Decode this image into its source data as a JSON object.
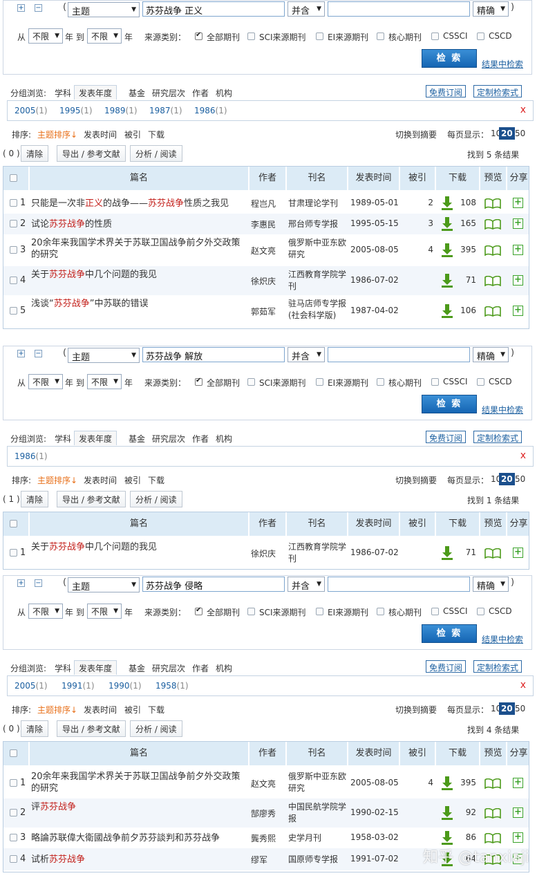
{
  "common": {
    "plus": "+",
    "minus": "−",
    "open_paren": "(",
    "close_paren": ")",
    "field": "主题",
    "combine": "并含",
    "match": "精确",
    "from": "从",
    "from_val": "不限",
    "to": "年 到",
    "to_val": "不限",
    "year": "年",
    "source_label": "来源类别：",
    "sources": [
      "全部期刊",
      "SCI来源期刊",
      "EI来源期刊",
      "核心期刊",
      "CSSCI",
      "CSCD"
    ],
    "search_btn": "检 索",
    "search_in": "结果中检索",
    "group_browse": "分组浏览:",
    "groups": [
      "学科",
      "发表年度",
      "基金",
      "研究层次",
      "作者",
      "机构"
    ],
    "free_sub": "免费订阅",
    "custom": "定制检索式",
    "close_x": "x",
    "sort_label": "排序:",
    "sort_topic": "主题排序↓",
    "sort_time": "发表时间",
    "sort_cited": "被引",
    "sort_dl": "下载",
    "switch_abs": "切换到摘要",
    "per_page": "每页显示：",
    "pages": [
      "10",
      "20",
      "50"
    ],
    "clear": "清除",
    "export": "导出 / 参考文献",
    "analyze": "分析 / 阅读",
    "headers": [
      "篇名",
      "作者",
      "刊名",
      "发表时间",
      "被引",
      "下载",
      "预览",
      "分享"
    ]
  },
  "blocks": [
    {
      "query": "苏芬战争 正义",
      "years": [
        {
          "y": "2005",
          "c": "(1)"
        },
        {
          "y": "1995",
          "c": "(1)"
        },
        {
          "y": "1989",
          "c": "(1)"
        },
        {
          "y": "1987",
          "c": "(1)"
        },
        {
          "y": "1986",
          "c": "(1)"
        }
      ],
      "count_sel": "( 0 )",
      "found": "找到 5 条结果",
      "rows": [
        {
          "n": "1",
          "title": [
            {
              "t": "只能是一次非"
            },
            {
              "t": "正义",
              "h": true
            },
            {
              "t": "的战争——"
            },
            {
              "t": "苏芬战争",
              "h": true
            },
            {
              "t": "性质之我见"
            }
          ],
          "author": "程岂凡",
          "journal": "甘肃理论学刊",
          "date": "1989-05-01",
          "cited": "2",
          "dl": "108"
        },
        {
          "n": "2",
          "title": [
            {
              "t": "试论"
            },
            {
              "t": "苏芬战争",
              "h": true
            },
            {
              "t": "的性质"
            }
          ],
          "author": "李惠民",
          "journal": "邢台师专学报",
          "date": "1995-05-15",
          "cited": "3",
          "dl": "165"
        },
        {
          "n": "3",
          "title": [
            {
              "t": "20余年来我国学术界关于苏联卫国战争前夕外交政策的研究"
            }
          ],
          "author": "赵文亮",
          "journal": "俄罗斯中亚东欧研究",
          "jpink": true,
          "date": "2005-08-05",
          "cited": "4",
          "dl": "395"
        },
        {
          "n": "4",
          "title": [
            {
              "t": "关于"
            },
            {
              "t": "苏芬战争",
              "h": true
            },
            {
              "t": "中几个问题的我见"
            }
          ],
          "author": "徐炽庆",
          "journal": "江西教育学院学刊",
          "date": "1986-07-02",
          "cited": "",
          "dl": "71"
        },
        {
          "n": "5",
          "title": [
            {
              "t": "浅谈“"
            },
            {
              "t": "苏芬战争",
              "h": true
            },
            {
              "t": "”中苏联的错误"
            }
          ],
          "author": "郭茹军",
          "journal": "驻马店师专学报(社会科学版)",
          "date": "1987-04-02",
          "cited": "",
          "dl": "106"
        }
      ]
    },
    {
      "query": "苏芬战争 解放",
      "years": [
        {
          "y": "1986",
          "c": "(1)"
        }
      ],
      "count_sel": "( 1 )",
      "found": "找到 1 条结果",
      "rows": [
        {
          "n": "1",
          "title": [
            {
              "t": "关于"
            },
            {
              "t": "苏芬战争",
              "h": true
            },
            {
              "t": "中几个问题的我见"
            }
          ],
          "author": "徐炽庆",
          "journal": "江西教育学院学刊",
          "date": "1986-07-02",
          "cited": "",
          "dl": "71"
        }
      ]
    },
    {
      "query": "苏芬战争 侵略",
      "years": [
        {
          "y": "2005",
          "c": "(1)"
        },
        {
          "y": "1991",
          "c": "(1)"
        },
        {
          "y": "1990",
          "c": "(1)"
        },
        {
          "y": "1958",
          "c": "(1)"
        }
      ],
      "count_sel": "( 0 )",
      "found": "找到 4 条结果",
      "rows": [
        {
          "n": "1",
          "title": [
            {
              "t": "20余年来我国学术界关于苏联卫国战争前夕外交政策的研究"
            }
          ],
          "author": "赵文亮",
          "journal": "俄罗斯中亚东欧研究",
          "jpink": true,
          "date": "2005-08-05",
          "cited": "4",
          "dl": "395"
        },
        {
          "n": "2",
          "title": [
            {
              "t": "评"
            },
            {
              "t": "苏芬战争",
              "h": true
            }
          ],
          "author": "郜廖秀",
          "journal": "中国民航学院学报",
          "date": "1990-02-15",
          "cited": "",
          "dl": "92"
        },
        {
          "n": "3",
          "title": [
            {
              "t": "略論苏联偉大衛國战争前夕苏芬談判和苏芬战争"
            }
          ],
          "author": "龔秀熙",
          "journal": "史学月刊",
          "jpink": true,
          "date": "1958-03-02",
          "cited": "",
          "dl": "86"
        },
        {
          "n": "4",
          "title": [
            {
              "t": "试析"
            },
            {
              "t": "苏芬战争",
              "h": true
            }
          ],
          "author": "缪军",
          "journal": "国原师专学报",
          "date": "1991-07-02",
          "cited": "",
          "dl": "64"
        }
      ]
    }
  ],
  "watermark": "知乎 @tanxiaji"
}
